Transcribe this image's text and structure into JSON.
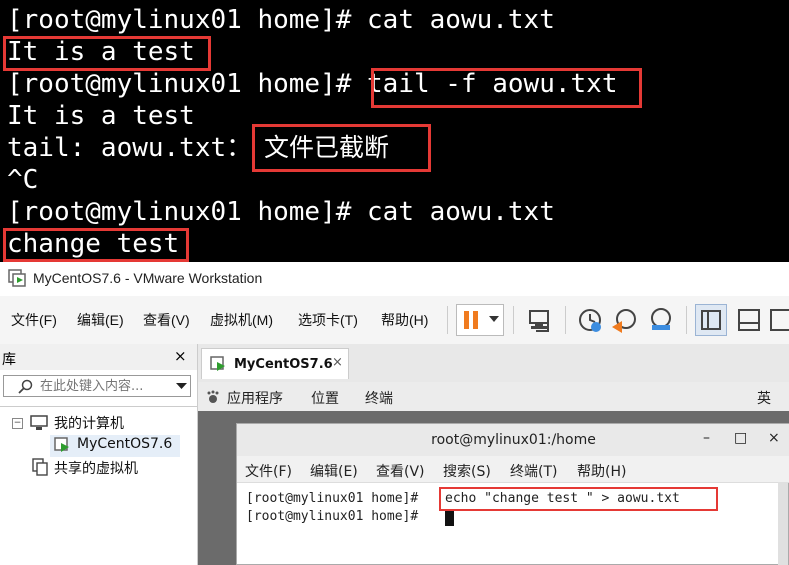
{
  "top_terminal": {
    "lines": [
      "[root@mylinux01 home]# cat aowu.txt",
      "It is a test",
      "[root@mylinux01 home]# tail -f aowu.txt",
      "It is a test",
      "tail: aowu.txt：",
      "^C",
      "[root@mylinux01 home]# cat aowu.txt",
      "change test"
    ],
    "truncated_msg": "文件已截断",
    "highlight_color": "#e53935"
  },
  "vmware": {
    "title": "MyCentOS7.6 - VMware Workstation",
    "menu": [
      "文件(F)",
      "编辑(E)",
      "查看(V)",
      "虚拟机(M)",
      "选项卡(T)",
      "帮助(H)"
    ],
    "library": {
      "title": "库",
      "close": "×",
      "search_placeholder": "在此处键入内容...",
      "tree": {
        "my_computer": "我的计算机",
        "vm": "MyCentOS7.6",
        "shared": "共享的虚拟机"
      }
    },
    "tab": {
      "label": "MyCentOS7.6",
      "close": "×"
    },
    "gnome": {
      "apps": "应用程序",
      "places": "位置",
      "terminal": "终端",
      "lang": "英"
    },
    "inner_terminal": {
      "title": "root@mylinux01:/home",
      "buttons": {
        "min": "–",
        "max": "□",
        "close": "×"
      },
      "menu": [
        "文件(F)",
        "编辑(E)",
        "查看(V)",
        "搜索(S)",
        "终端(T)",
        "帮助(H)"
      ],
      "prompt": "[root@mylinux01 home]#",
      "command": "echo \"change test \" > aowu.txt"
    },
    "accent_pause": "#f07b1f"
  }
}
